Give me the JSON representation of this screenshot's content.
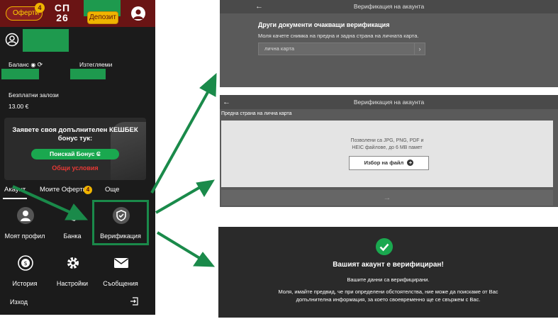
{
  "colors": {
    "brand": "#6a1414",
    "accent": "#f0b400",
    "arrow": "#1a8a4a",
    "green": "#1aa84f"
  },
  "phone": {
    "offers_label": "Оферти",
    "offers_badge": "4",
    "logo_line1": "СП",
    "logo_line2": "26",
    "deposit_label": "Депозит",
    "balance_label": "Баланс",
    "withdraw_label": "Изтегляеми",
    "free_bets_label": "Безплатни залози",
    "free_bets_value": "13.00 €",
    "promo_text": "Заявете своя допълнителен КЕШБЕК бонус тук:",
    "promo_button": "Поискай Бонус ₢",
    "promo_terms": "Общи условия",
    "tabs": {
      "account": "Акаунт",
      "offers": "Моите Оферти",
      "offers_badge": "4",
      "more": "Още"
    },
    "tiles": {
      "profile": "Моят профил",
      "bank": "Банка",
      "verification": "Верификация",
      "history": "История",
      "settings": "Настройки",
      "messages": "Съобщения"
    },
    "logout_label": "Изход"
  },
  "screen1": {
    "header": "Верификация на акаунта",
    "title": "Други документи очакващи верификация",
    "subtitle": "Моля качете снимка на предна и задна страна на личната карта.",
    "select_value": "лична карта"
  },
  "screen2": {
    "header": "Верификация на акаунта",
    "label": "Предна страна на лична карта",
    "allowed_line1": "Позволени са JPG, PNG, PDF и",
    "allowed_line2": "HEIC файлове, до 6 MB памет",
    "choose_button": "Избор на файл"
  },
  "screen3": {
    "title": "Вашият акаунт е верифициран!",
    "line1": "Вашите данни са верифицирани.",
    "line2a": "Моля, имайте предвид, че при определени обстоятелства, ние може да поискаме от Вас",
    "line2b": "допълнителна информация, за което своевременно ще се свържем с Вас."
  }
}
